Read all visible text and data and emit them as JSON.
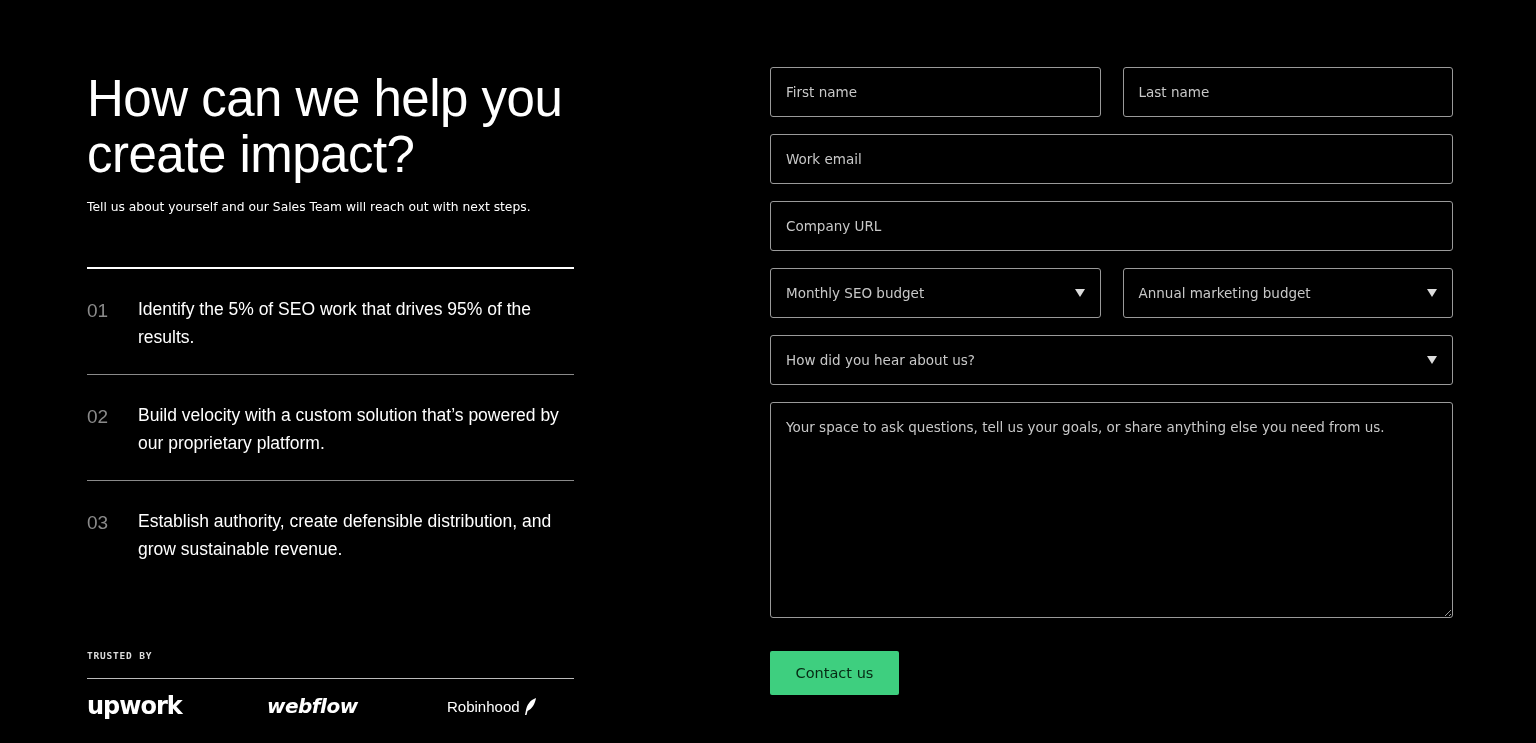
{
  "intro": {
    "heading": "How can we help you create impact?",
    "subtitle": "Tell us about yourself and our Sales Team will reach out with next steps."
  },
  "points": [
    {
      "number": "01",
      "text": "Identify the 5% of SEO work that drives 95% of the results."
    },
    {
      "number": "02",
      "text": "Build velocity with a custom solution that’s powered by our proprietary platform."
    },
    {
      "number": "03",
      "text": "Establish authority, create defensible distribution, and grow sustainable revenue."
    }
  ],
  "trusted": {
    "label": "TRUSTED BY",
    "logos": [
      {
        "kind": "upwork",
        "text": "upwork"
      },
      {
        "kind": "webflow",
        "text": "webflow"
      },
      {
        "kind": "robinhood",
        "text": "Robinhood"
      }
    ]
  },
  "form": {
    "rows": [
      [
        {
          "kind": "input",
          "placeholder": "First name"
        },
        {
          "kind": "input",
          "placeholder": "Last name"
        }
      ],
      [
        {
          "kind": "input",
          "placeholder": "Work email"
        }
      ],
      [
        {
          "kind": "input",
          "placeholder": "Company URL"
        }
      ],
      [
        {
          "kind": "select",
          "placeholder": "Monthly SEO budget"
        },
        {
          "kind": "select",
          "placeholder": "Annual marketing budget"
        }
      ],
      [
        {
          "kind": "select",
          "placeholder": "How did you hear about us?"
        }
      ],
      [
        {
          "kind": "textarea",
          "placeholder": "Your space to ask questions, tell us your goals, or share anything else you need from us."
        }
      ]
    ],
    "submit": "Contact us"
  }
}
